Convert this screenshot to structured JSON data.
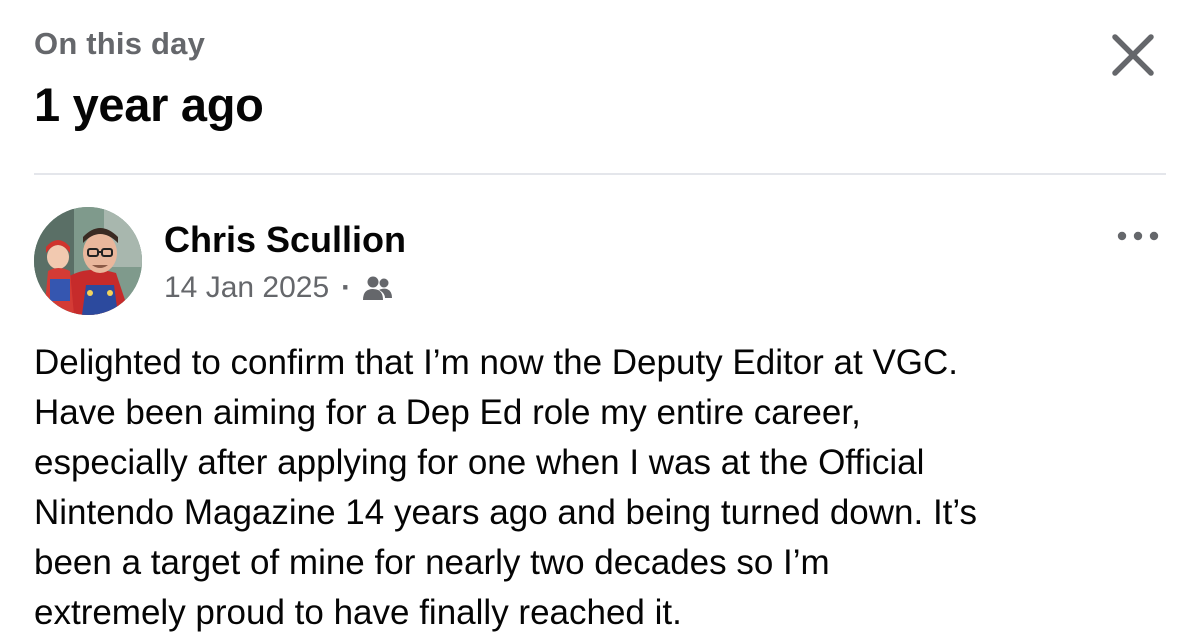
{
  "header": {
    "kicker": "On this day",
    "title": "1 year ago",
    "close_icon": "close-icon"
  },
  "post": {
    "author": "Chris Scullion",
    "date": "14 Jan 2025",
    "separator": "·",
    "audience_icon": "friends-icon",
    "more_icon": "more-options-icon",
    "text": "Delighted to confirm that I’m now the Deputy Editor at VGC.\nHave been aiming for a Dep Ed role my entire career,\nespecially after applying for one when I was at the Official\nNintendo Magazine 14 years ago and being turned down. It’s\nbeen a target of mine for nearly two decades so I’m\nextremely proud to have finally reached it."
  },
  "colors": {
    "primary_text": "#050505",
    "secondary_text": "#65676b",
    "divider": "#e4e6eb"
  }
}
